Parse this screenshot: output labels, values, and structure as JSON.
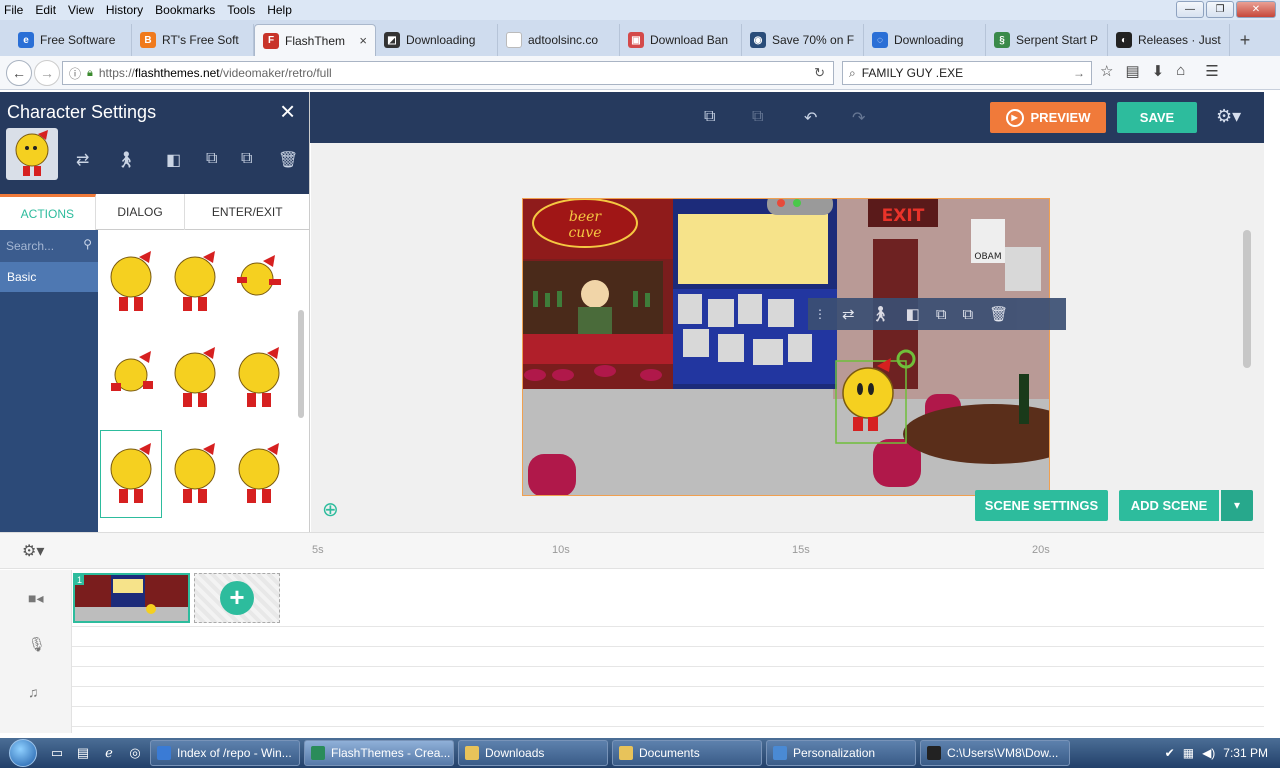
{
  "browser": {
    "menu": [
      "File",
      "Edit",
      "View",
      "History",
      "Bookmarks",
      "Tools",
      "Help"
    ],
    "window_controls": {
      "minimize": "—",
      "maximize": "❐",
      "close": "✕"
    },
    "tabs": [
      {
        "label": "Free Software",
        "color": "#2a6fd6",
        "glyph": "e"
      },
      {
        "label": "RT's Free Soft",
        "color": "#f07a1c",
        "glyph": "B"
      },
      {
        "label": "FlashThem",
        "color": "#c8342a",
        "glyph": "F",
        "active": true
      },
      {
        "label": "Downloading",
        "color": "#333333",
        "glyph": "◩"
      },
      {
        "label": "adtoolsinc.co",
        "color": "#ffffff",
        "glyph": ""
      },
      {
        "label": "Download Ban",
        "color": "#d44a4a",
        "glyph": "▣"
      },
      {
        "label": "Save 70% on F",
        "color": "#2a4d7a",
        "glyph": "◉"
      },
      {
        "label": "Downloading",
        "color": "#2a6fd6",
        "glyph": "◌"
      },
      {
        "label": "Serpent Start P",
        "color": "#3a8a4a",
        "glyph": "§"
      },
      {
        "label": "Releases · Just",
        "color": "#222222",
        "glyph": "◐"
      }
    ],
    "tab_close": "×",
    "new_tab": "+",
    "url": {
      "scheme": "https://",
      "domain": "flashthemes.net",
      "path": "/videomaker/retro/full"
    },
    "search_value": "FAMILY GUY .EXE"
  },
  "app": {
    "preview_label": "PREVIEW",
    "save_label": "SAVE",
    "scene_settings_label": "SCENE SETTINGS",
    "add_scene_label": "ADD SCENE"
  },
  "panel": {
    "title": "Character Settings",
    "close": "×",
    "tabs": [
      "ACTIONS",
      "DIALOG",
      "ENTER/EXIT"
    ],
    "search_placeholder": "Search...",
    "categories": [
      "Basic"
    ]
  },
  "timeline": {
    "ticks": [
      "5s",
      "10s",
      "15s",
      "20s"
    ],
    "scene_number": "1"
  },
  "taskbar": {
    "items": [
      {
        "label": "Index of /repo - Win...",
        "color": "#3a7bd5"
      },
      {
        "label": "FlashThemes - Crea...",
        "color": "#2a8c5a",
        "active": true
      },
      {
        "label": "Downloads",
        "color": "#e8c35a"
      },
      {
        "label": "Documents",
        "color": "#e8c35a"
      },
      {
        "label": "Personalization",
        "color": "#4a8ad4"
      },
      {
        "label": "C:\\Users\\VM8\\Dow...",
        "color": "#222222"
      }
    ],
    "clock": "7:31 PM"
  }
}
